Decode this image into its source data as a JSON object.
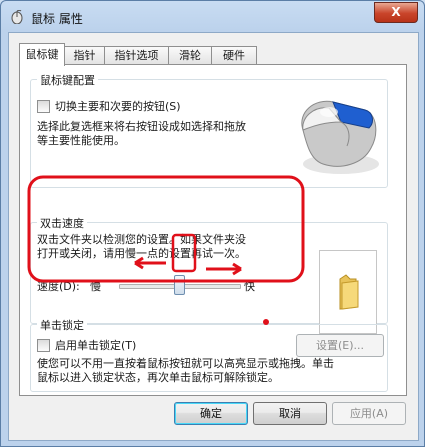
{
  "window": {
    "title": "鼠标 属性",
    "close_label": "X"
  },
  "tabs": [
    {
      "label": "鼠标键",
      "active": true
    },
    {
      "label": "指针",
      "active": false
    },
    {
      "label": "指针选项",
      "active": false
    },
    {
      "label": "滑轮",
      "active": false
    },
    {
      "label": "硬件",
      "active": false
    }
  ],
  "button_config": {
    "legend": "鼠标键配置",
    "checkbox_label": "切换主要和次要的按钮(S)",
    "checked": false,
    "description_line1": "选择此复选框来将右按钮设成如选择和拖放",
    "description_line2": "等主要性能使用。"
  },
  "double_click": {
    "legend": "双击速度",
    "description_line1": "双击文件夹以检测您的设置。如果文件夹没",
    "description_line2": "打开或关闭，请用慢一点的设置再试一次。",
    "speed_label": "速度(D):",
    "slow_label": "慢",
    "fast_label": "快",
    "speed_fraction": 0.5
  },
  "click_lock": {
    "legend": "单击锁定",
    "checkbox_label": "启用单击锁定(T)",
    "checked": false,
    "settings_button": "设置(E)...",
    "description_line1": "使您可以不用一直按着鼠标按钮就可以高亮显示或拖拽。单击",
    "description_line2": "鼠标以进入锁定状态，再次单击鼠标可解除锁定。"
  },
  "footer": {
    "ok_label": "确定",
    "cancel_label": "取消",
    "apply_label": "应用(A)"
  },
  "annotation_color": "#e0101a"
}
